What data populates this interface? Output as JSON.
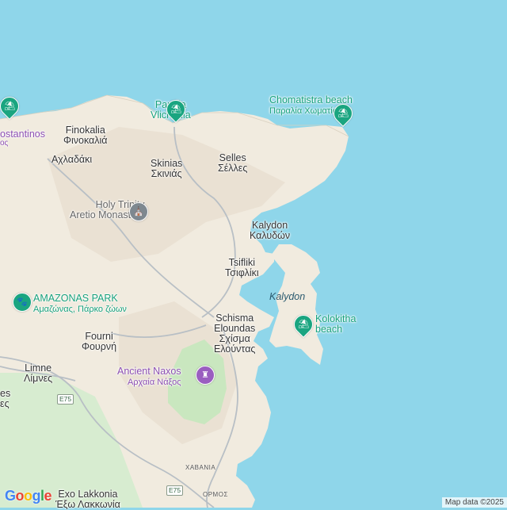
{
  "map": {
    "colors": {
      "sea": "#8fd6ea",
      "land": "#f1ebdf",
      "relief": "#e9dfcf",
      "park": "#c9e7bf",
      "forest": "#d7ecd0",
      "road": "#b8bfc5",
      "poi_green": "#1aa580",
      "poi_purple": "#8c4fb3"
    },
    "places": [
      {
        "id": "konstantinos",
        "line1": "ostantinos",
        "line2": "ος",
        "kind": "poi-purple"
      },
      {
        "id": "paralia-vlichadia",
        "line1": "Paralia",
        "line2": "Vlichadia",
        "kind": "poi",
        "icon": "beach-icon"
      },
      {
        "id": "chomatistra-beach",
        "line1": "Chomatistra beach",
        "line2": "Παραλία Χωματίστρα",
        "kind": "poi",
        "icon": "beach-icon"
      },
      {
        "id": "finokalia",
        "line1": "Finokalia",
        "line2": "Φινοκαλιά",
        "kind": "town"
      },
      {
        "id": "achladaki",
        "line1": "Αχλαδάκι",
        "line2": "",
        "kind": "town"
      },
      {
        "id": "skinias",
        "line1": "Skinias",
        "line2": "Σκινιάς",
        "kind": "town"
      },
      {
        "id": "selles",
        "line1": "Selles",
        "line2": "Σέλλες",
        "kind": "town"
      },
      {
        "id": "holy-trinity",
        "line1": "Holy Trinity",
        "line2": "Aretio Monastery",
        "kind": "poi-gray",
        "icon": "monastery-icon"
      },
      {
        "id": "kalydon-village",
        "line1": "Kalydon",
        "line2": "Καλυδών",
        "kind": "town"
      },
      {
        "id": "tsifliki",
        "line1": "Tsifliki",
        "line2": "Τσιφλίκι",
        "kind": "town"
      },
      {
        "id": "amazonas-park",
        "line1": "AMAZONAS PARK",
        "line2": "Αμαζώνας, Πάρκο ζώων",
        "kind": "poi",
        "icon": "zoo-icon"
      },
      {
        "id": "kalydon-island",
        "line1": "Kalydon",
        "line2": "",
        "kind": "sea"
      },
      {
        "id": "kolokitha-beach",
        "line1": "Kolokitha",
        "line2": "beach",
        "kind": "poi",
        "icon": "beach-icon"
      },
      {
        "id": "schisma-eloundas",
        "line1": "Schisma",
        "line2": "Eloundas",
        "line3": "Σχίσμα",
        "line4": "Ελούντας",
        "kind": "town"
      },
      {
        "id": "fourni",
        "line1": "Fourni",
        "line2": "Φουρνή",
        "kind": "town"
      },
      {
        "id": "limne",
        "line1": "Limne",
        "line2": "Λίμνες",
        "kind": "town"
      },
      {
        "id": "limnes-left",
        "line1": "es",
        "line2": "ες",
        "kind": "town"
      },
      {
        "id": "ancient-naxos",
        "line1": "Ancient Naxos",
        "line2": "Αρχαία Νάξος",
        "kind": "poi-purple",
        "icon": "ruins-icon"
      },
      {
        "id": "exo-lakkonia",
        "line1": "Exo Lakkonia",
        "line2": "Έξω Λακκωνία",
        "kind": "town"
      }
    ],
    "road_labels": {
      "e75_top": "E75",
      "e75_bottom": "E75"
    },
    "small_towns": {
      "chavania": "ΧΑΒΑΝΙΑ",
      "ormos": "ΟΡΜΟΣ"
    },
    "branding": {
      "logo": "Google",
      "attribution": "Map data ©2025"
    }
  }
}
